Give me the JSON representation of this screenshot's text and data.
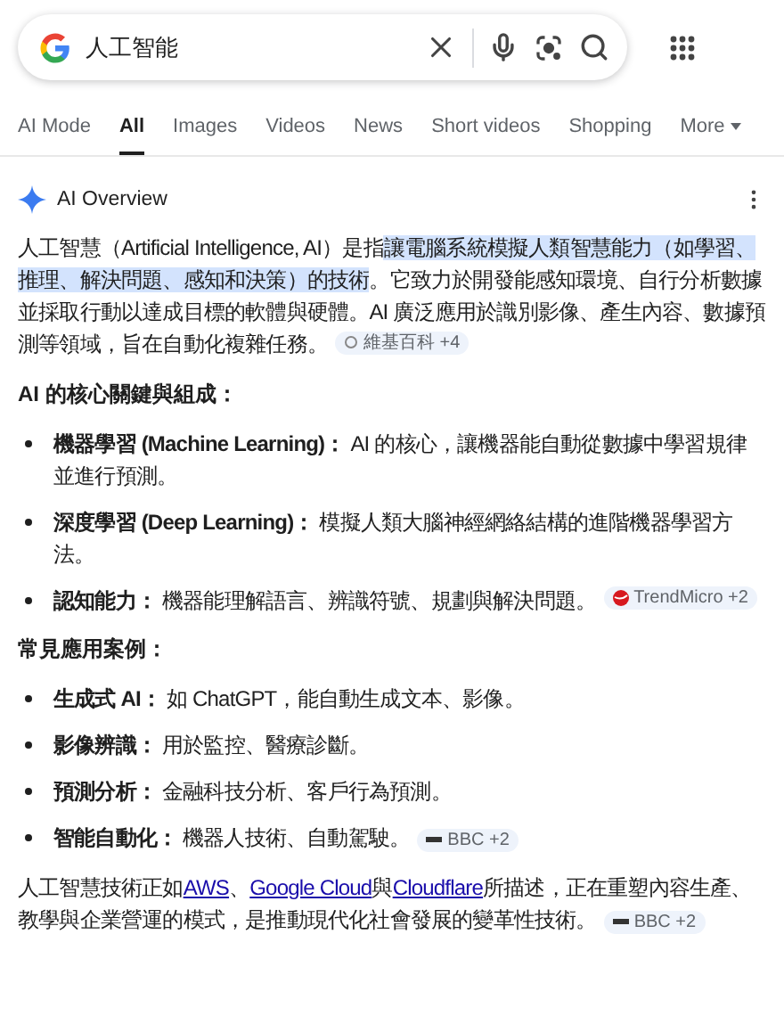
{
  "search": {
    "value": "人工智能"
  },
  "tabs": [
    {
      "label": "AI Mode",
      "selected": false
    },
    {
      "label": "All",
      "selected": true
    },
    {
      "label": "Images",
      "selected": false
    },
    {
      "label": "Videos",
      "selected": false
    },
    {
      "label": "News",
      "selected": false
    },
    {
      "label": "Short videos",
      "selected": false
    },
    {
      "label": "Shopping",
      "selected": false
    },
    {
      "label": "More",
      "selected": false,
      "kind": "menu"
    }
  ],
  "overview": {
    "title": "AI Overview",
    "blocks": [
      {
        "kind": "paragraph",
        "parts": [
          {
            "text": "人工智慧（Artificial Intelligence, AI）是指",
            "highlighted": false
          },
          {
            "text": "讓電腦系統模擬人類智慧能力（如學習、推理、解決問題、感知和決策）的技術",
            "highlighted": true
          },
          {
            "text": "。它致力於開發能感知環境、自行分析數據並採取行動以達成目標的軟體與硬體。AI 廣泛應用於識別影像、產生內容、數據預測等領域，旨在自動化複雜任務。",
            "highlighted": false
          }
        ],
        "chip": {
          "kind": "circle",
          "label": "維基百科 +4"
        }
      },
      {
        "kind": "heading",
        "text": "AI 的核心關鍵與組成："
      },
      {
        "kind": "list",
        "items": [
          {
            "label": "機器學習 (Machine Learning)：",
            "text": "AI 的核心，讓機器能自動從數據中學習規律並進行預測。"
          },
          {
            "label": "深度學習 (Deep Learning)：",
            "text": "模擬人類大腦神經網絡結構的進階機器學習方法。"
          },
          {
            "label": "認知能力：",
            "text": "機器能理解語言、辨識符號、規劃與解決問題。",
            "chip": {
              "kind": "ball",
              "label": "TrendMicro +2"
            }
          }
        ]
      },
      {
        "kind": "heading",
        "text": "常見應用案例："
      },
      {
        "kind": "list",
        "items": [
          {
            "label": "生成式 AI：",
            "text": "如 ChatGPT，能自動生成文本、影像。"
          },
          {
            "label": "影像辨識：",
            "text": "用於監控、醫療診斷。"
          },
          {
            "label": "預測分析：",
            "text": "金融科技分析、客戶行為預測。"
          },
          {
            "label": "智能自動化：",
            "text": "機器人技術、自動駕駛。",
            "chip": {
              "kind": "bar",
              "label": "BBC +2"
            }
          }
        ]
      },
      {
        "kind": "paragraph",
        "parts": [
          {
            "text": "人工智慧技術正如",
            "kind": "text"
          },
          {
            "text": "AWS",
            "kind": "link"
          },
          {
            "text": "、",
            "kind": "text"
          },
          {
            "text": "Google Cloud",
            "kind": "link"
          },
          {
            "text": "與",
            "kind": "text"
          },
          {
            "text": "Cloudflare",
            "kind": "link"
          },
          {
            "text": "所描述，正在重塑內容生產、教學與企業營運的模式，是推動現代化社會發展的變革性技術。",
            "kind": "text"
          }
        ],
        "chip": {
          "kind": "bar",
          "label": "BBC +2"
        }
      }
    ]
  }
}
